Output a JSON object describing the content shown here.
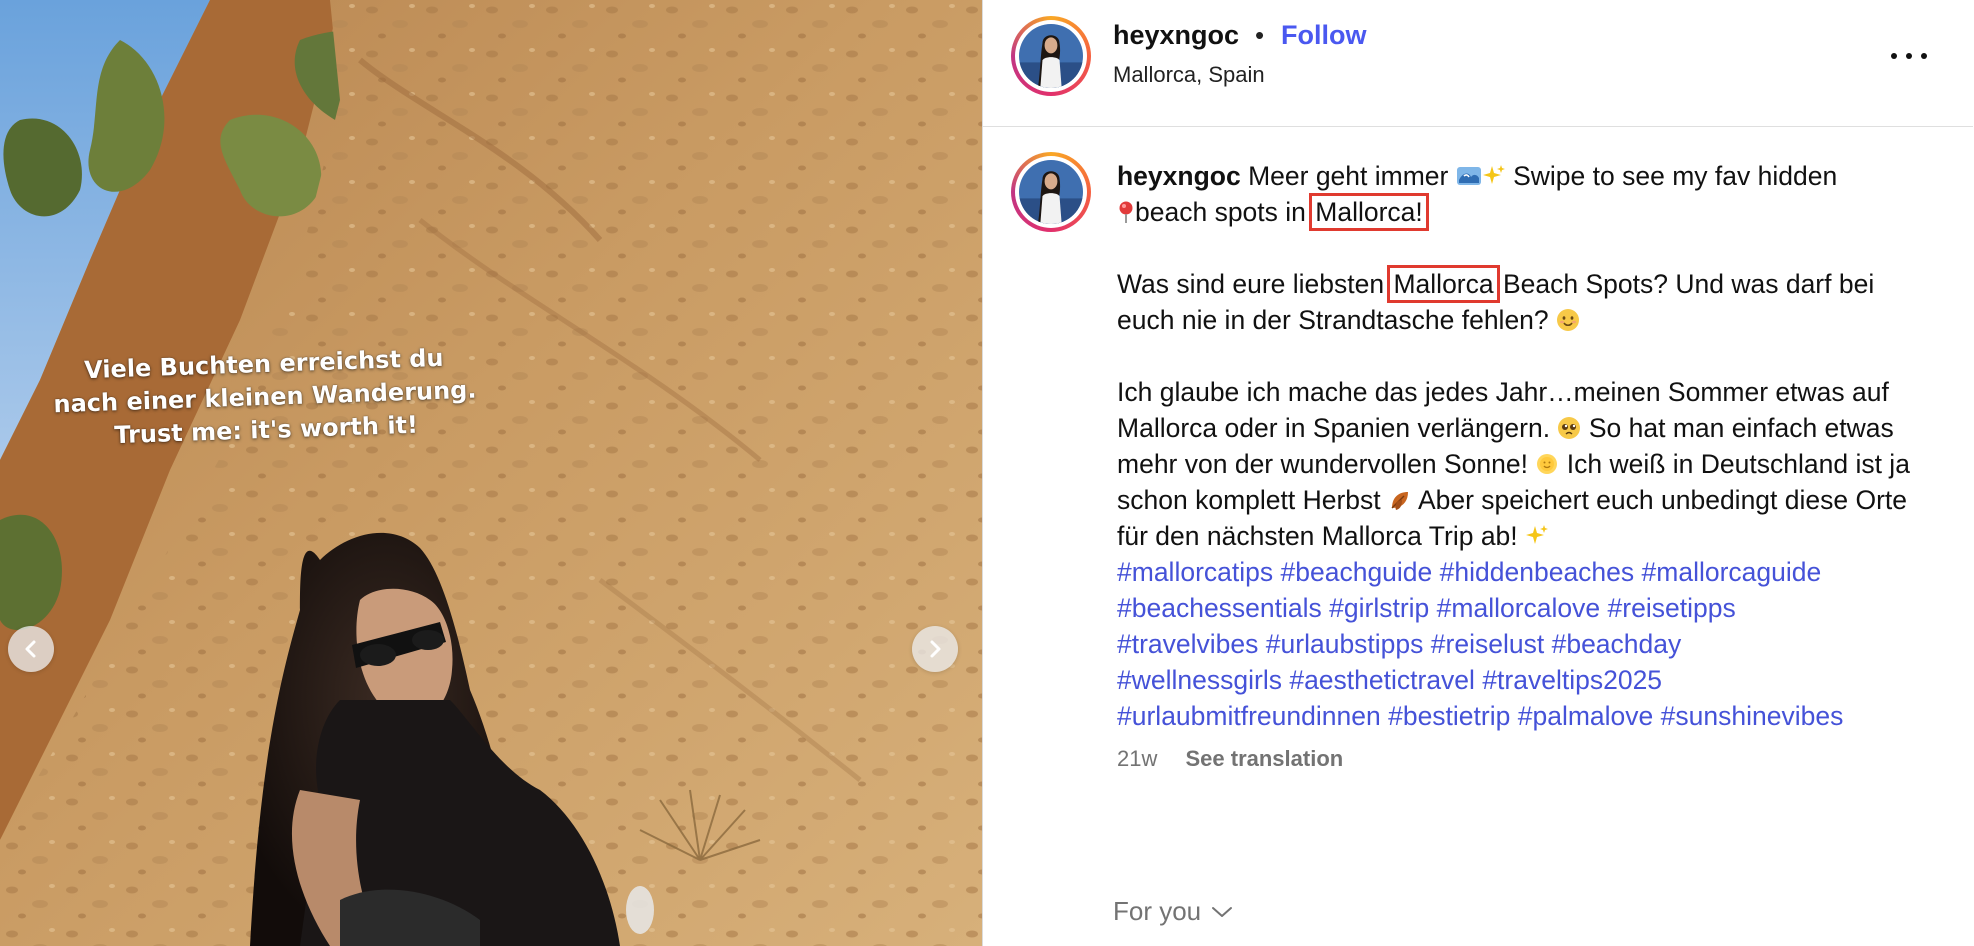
{
  "media": {
    "overlay_lines": [
      "Viele Buchten erreichst du",
      "nach einer kleinen Wanderung.",
      "Trust me: it's worth it!"
    ],
    "prev_icon": "chevron-left-icon",
    "next_icon": "chevron-right-icon"
  },
  "header": {
    "username": "heyxngoc",
    "separator": "•",
    "follow_label": "Follow",
    "location": "Mallorca, Spain",
    "more_icon": "more-horizontal-icon"
  },
  "caption": {
    "username": "heyxngoc",
    "line1_a": "Meer geht immer",
    "line1_b": "Swipe to see my fav hidden",
    "line2_a": "beach spots in",
    "line2_highlight": "Mallorca!",
    "p2_a": "Was sind eure liebsten",
    "p2_highlight": "Mallorca",
    "p2_b": "Beach Spots? Und was darf bei euch nie in der Strandtasche fehlen?",
    "p3_a": "Ich glaube ich mache das jedes Jahr…meinen Sommer etwas auf Mallorca oder in Spanien verlängern.",
    "p3_b": "So hat man einfach etwas mehr von der wundervollen Sonne!",
    "p3_c": "Ich weiß in Deutschland ist ja schon komplett Herbst",
    "p3_d": "Aber speichert euch unbedingt diese Orte für den nächsten Mallorca Trip ab!",
    "emojis": [
      "wave-icon",
      "sparkles-icon",
      "pin-icon",
      "smile-icon",
      "pleading-face-icon",
      "sun-icon",
      "leaves-icon",
      "sparkles-icon"
    ]
  },
  "hashtags": [
    "#mallorcatips",
    "#beachguide",
    "#hiddenbeaches",
    "#mallorcaguide",
    "#beachessentials",
    "#girlstrip",
    "#mallorcalove",
    "#reisetipps",
    "#travelvibes",
    "#urlaubstipps",
    "#reiselust",
    "#beachday",
    "#wellnessgirls",
    "#aesthetictravel",
    "#traveltips2025",
    "#urlaubmitfreundinnen",
    "#bestietrip",
    "#palmalove",
    "#sunshinevibes"
  ],
  "meta": {
    "time": "21w",
    "translate_label": "See translation"
  },
  "footer": {
    "for_you_label": "For you",
    "for_you_icon": "chevron-down-icon"
  },
  "colors": {
    "follow": "#4a58f0",
    "hashtag": "#4552d8",
    "highlight_box": "#e03a2f",
    "muted": "#737373"
  }
}
